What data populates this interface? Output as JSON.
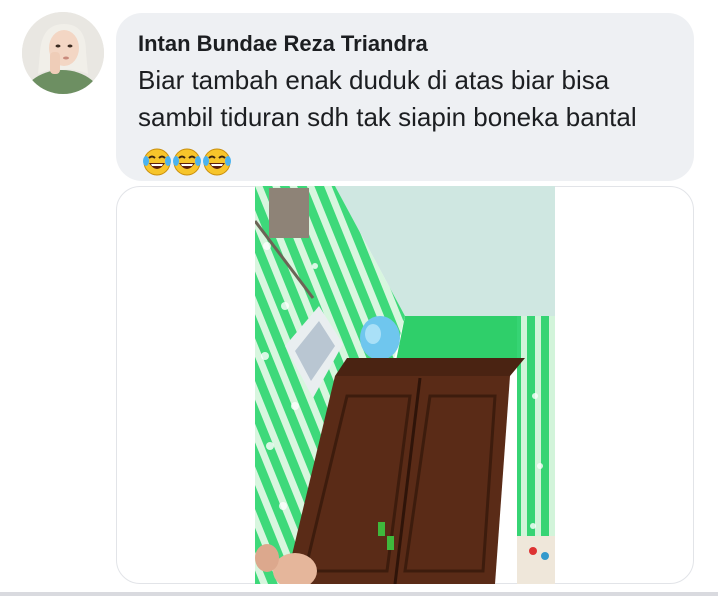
{
  "comment": {
    "author": "Intan Bundae Reza Triandra",
    "message": "Biar tambah enak duduk di atas biar bisa sambil tiduran sdh tak siapin boneka bantal",
    "emoji": "face-with-tears-of-joy",
    "emoji_count": 3
  },
  "attachment": {
    "type": "photo"
  },
  "colors": {
    "bubble": "#eef0f3",
    "text": "#1c1e21",
    "wall": "#3ed97a",
    "wardrobe": "#5a2b17"
  }
}
